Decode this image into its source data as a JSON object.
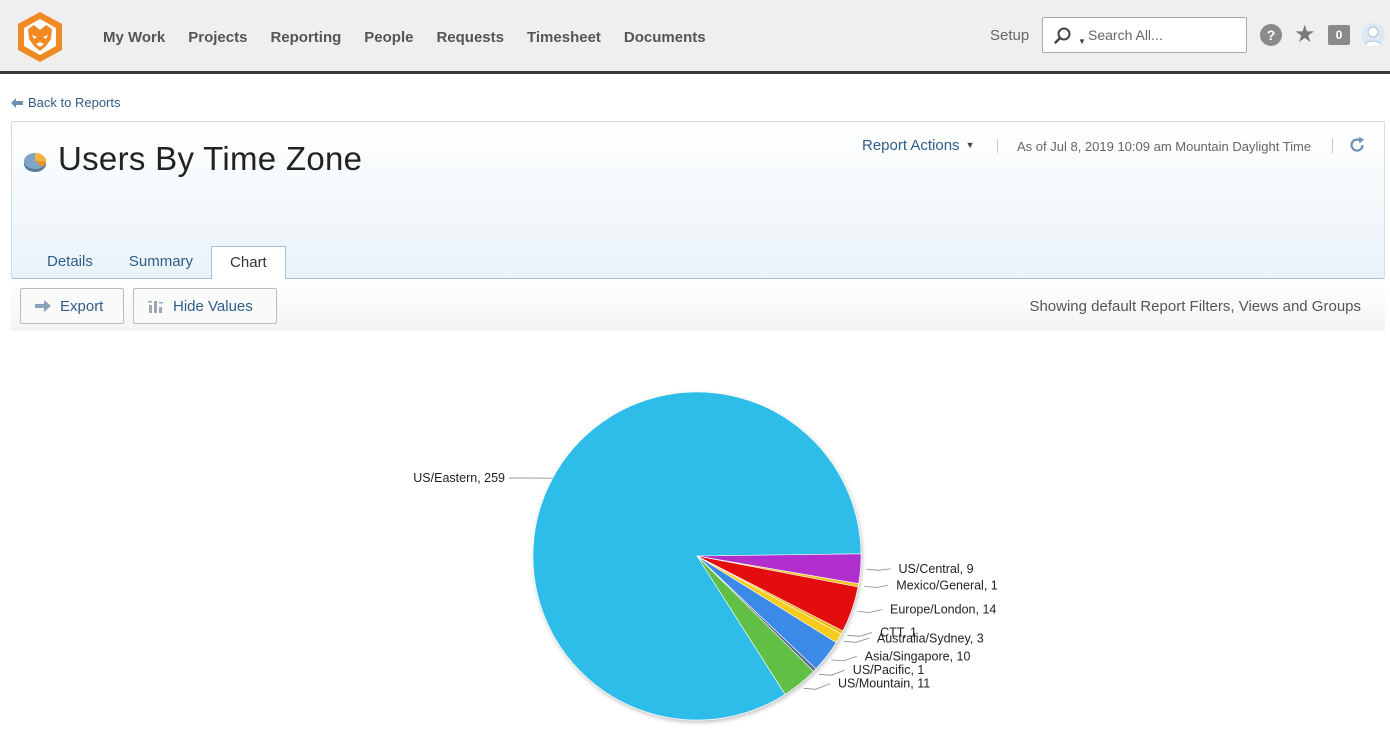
{
  "nav": {
    "items": [
      "My Work",
      "Projects",
      "Reporting",
      "People",
      "Requests",
      "Timesheet",
      "Documents"
    ],
    "setup_label": "Setup",
    "search_placeholder": "Search All...",
    "help_label": "?",
    "notification_count": "0"
  },
  "back_link": "Back to Reports",
  "header": {
    "title": "Users By Time Zone",
    "report_actions_label": "Report Actions",
    "timestamp": "As of Jul 8, 2019 10:09 am Mountain Daylight Time"
  },
  "tabs": [
    {
      "label": "Details",
      "active": false
    },
    {
      "label": "Summary",
      "active": false
    },
    {
      "label": "Chart",
      "active": true
    }
  ],
  "toolbar": {
    "export_label": "Export",
    "hide_values_label": "Hide Values",
    "filters_text": "Showing default Report Filters, Views and Groups"
  },
  "chart_data": {
    "type": "pie",
    "title": "",
    "slices": [
      {
        "label": "US/Eastern, 259",
        "name": "US/Eastern",
        "value": 259,
        "color": "#2ebde9"
      },
      {
        "label": "US/Central, 9",
        "name": "US/Central",
        "value": 9,
        "color": "#b12fcf"
      },
      {
        "label": "Mexico/General, 1",
        "name": "Mexico/General",
        "value": 1,
        "color": "#f2c01a"
      },
      {
        "label": "Europe/London, 14",
        "name": "Europe/London",
        "value": 14,
        "color": "#e30a0a"
      },
      {
        "label": "CTT, 1",
        "name": "CTT",
        "value": 1,
        "color": "#e8b818"
      },
      {
        "label": "Australia/Sydney, 3",
        "name": "Australia/Sydney",
        "value": 3,
        "color": "#f5cc1c"
      },
      {
        "label": "Asia/Singapore, 10",
        "name": "Asia/Singapore",
        "value": 10,
        "color": "#3b8ae8"
      },
      {
        "label": "US/Pacific, 1",
        "name": "US/Pacific",
        "value": 1,
        "color": "#5a6a8c"
      },
      {
        "label": "US/Mountain, 11",
        "name": "US/Mountain",
        "value": 11,
        "color": "#62bf44"
      }
    ]
  },
  "colors": {
    "link": "#2f5d8a",
    "brand_orange": "#f08a24"
  }
}
